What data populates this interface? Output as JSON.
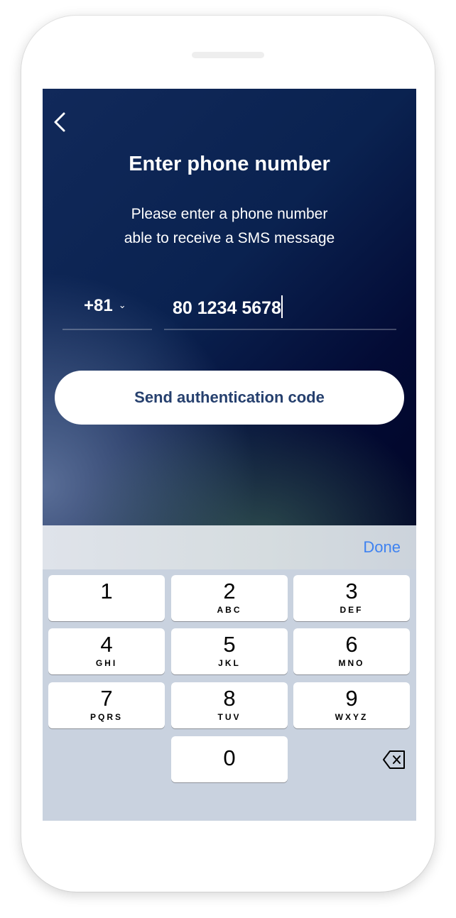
{
  "header": {
    "title": "Enter phone number",
    "subtitle_line1": "Please enter a phone number",
    "subtitle_line2": "able to receive a SMS message"
  },
  "form": {
    "country_code": "+81",
    "phone_number": "80 1234 5678",
    "submit_label": "Send authentication code"
  },
  "keyboard": {
    "done_label": "Done",
    "keys": [
      {
        "digit": "1",
        "letters": ""
      },
      {
        "digit": "2",
        "letters": "ABC"
      },
      {
        "digit": "3",
        "letters": "DEF"
      },
      {
        "digit": "4",
        "letters": "GHI"
      },
      {
        "digit": "5",
        "letters": "JKL"
      },
      {
        "digit": "6",
        "letters": "MNO"
      },
      {
        "digit": "7",
        "letters": "PQRS"
      },
      {
        "digit": "8",
        "letters": "TUV"
      },
      {
        "digit": "9",
        "letters": "WXYZ"
      },
      {
        "digit": "0",
        "letters": ""
      }
    ],
    "accent": "#3f82f0"
  },
  "colors": {
    "button_text": "#26406e",
    "background": "#0a2250"
  }
}
